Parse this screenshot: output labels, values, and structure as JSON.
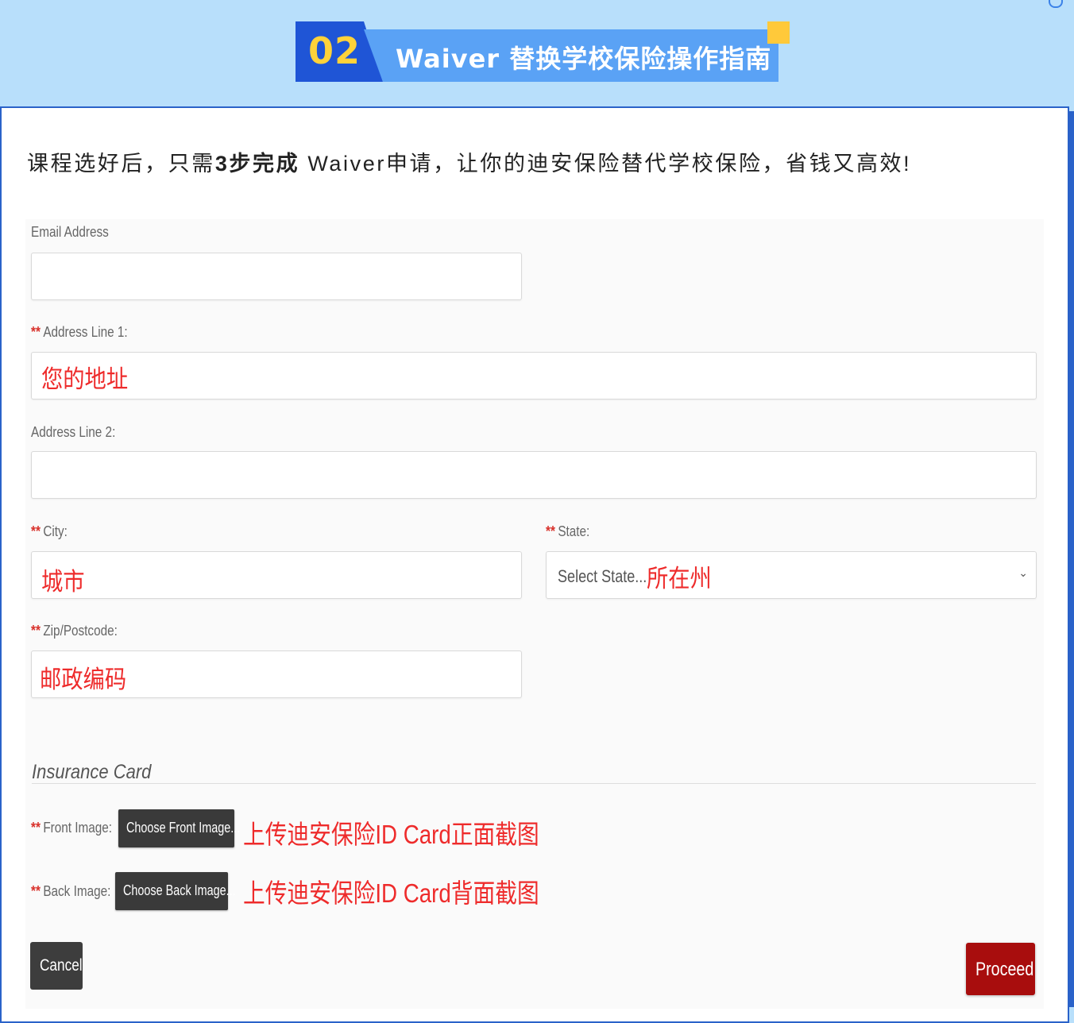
{
  "header": {
    "step_number": "02",
    "title": "Waiver 替换学校保险操作指南"
  },
  "intro": {
    "prefix": "课程选好后，只需",
    "bold": "3步完成",
    "suffix": " Waiver申请，让你的迪安保险替代学校保险，省钱又高效!"
  },
  "form": {
    "email": {
      "label": "Email Address",
      "value": ""
    },
    "address1": {
      "required": "**",
      "label": "Address Line 1:",
      "value": "您的地址"
    },
    "address2": {
      "label": "Address Line 2:",
      "value": ""
    },
    "city": {
      "required": "**",
      "label": "City:",
      "value": "城市"
    },
    "state": {
      "required": "**",
      "label": "State:",
      "placeholder": "Select State...",
      "note": "所在州"
    },
    "zip": {
      "required": "**",
      "label": "Zip/Postcode:",
      "value": "邮政编码"
    },
    "insurance_section": "Insurance Card",
    "front": {
      "required": "**",
      "label": "Front Image:",
      "button": "Choose Front Image...",
      "note": "上传迪安保险ID Card正面截图"
    },
    "back": {
      "required": "**",
      "label": "Back Image:",
      "button": "Choose Back Image...",
      "note": "上传迪安保险ID Card背面截图"
    },
    "cancel_label": "Cancel",
    "proceed_label": "Proceed"
  },
  "colors": {
    "banner_bg": "#b8dffb",
    "step_block": "#1f55d6",
    "step_number": "#ffd23a",
    "title_block": "#5aa2f5",
    "annotation_red": "#ee2b2b",
    "proceed": "#a80d0d",
    "cancel": "#3d3d3d"
  }
}
